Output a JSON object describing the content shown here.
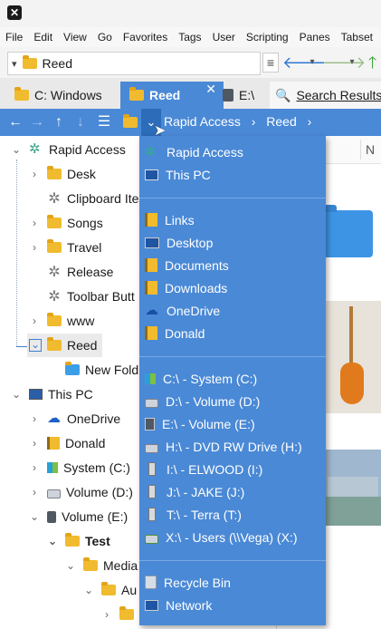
{
  "menu": [
    "File",
    "Edit",
    "View",
    "Go",
    "Favorites",
    "Tags",
    "User",
    "Scripting",
    "Panes",
    "Tabset"
  ],
  "address": {
    "value": "Reed"
  },
  "tabs": [
    {
      "label": "C: Windows",
      "active": false
    },
    {
      "label": "Reed",
      "active": true
    },
    {
      "label": "E:\\",
      "active": false
    },
    {
      "label": "Search Results",
      "active": false
    }
  ],
  "breadcrumb": {
    "items": [
      "Rapid Access",
      "Reed"
    ]
  },
  "tree": [
    {
      "label": "Rapid Access"
    },
    {
      "label": "Desk"
    },
    {
      "label": "Clipboard Ite"
    },
    {
      "label": "Songs"
    },
    {
      "label": "Travel"
    },
    {
      "label": "Release"
    },
    {
      "label": "Toolbar Butt"
    },
    {
      "label": "www"
    },
    {
      "label": "Reed"
    },
    {
      "label": "New Fold"
    },
    {
      "label": "This PC"
    },
    {
      "label": "OneDrive"
    },
    {
      "label": "Donald"
    },
    {
      "label": "System (C:)"
    },
    {
      "label": "Volume (D:)"
    },
    {
      "label": "Volume (E:)"
    },
    {
      "label": "Test"
    },
    {
      "label": "Media"
    },
    {
      "label": "Au"
    },
    {
      "label": "mps"
    }
  ],
  "right_pane": {
    "columns": [
      "bel",
      "N"
    ]
  },
  "dropdown": {
    "group1": [
      "Rapid Access",
      "This PC"
    ],
    "group2": [
      "Links",
      "Desktop",
      "Documents",
      "Downloads",
      "OneDrive",
      "Donald"
    ],
    "group3": [
      "C:\\ - System (C:)",
      "D:\\ - Volume (D:)",
      "E:\\ - Volume (E:)",
      "H:\\ - DVD RW Drive (H:)",
      "I:\\ - ELWOOD (I:)",
      "J:\\ - JAKE (J:)",
      "T:\\ - Terra (T:)",
      "X:\\ - Users (\\\\Vega) (X:)"
    ],
    "group4": [
      "Recycle Bin",
      "Network"
    ]
  },
  "colors": {
    "accent": "#4a89d6",
    "folder": "#f0bb2e",
    "selection": "#cce3f7"
  }
}
